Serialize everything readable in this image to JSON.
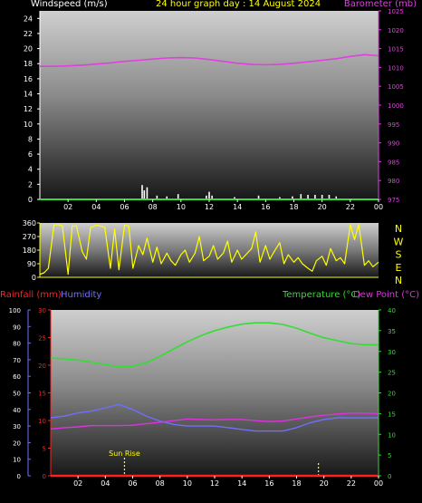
{
  "header": {
    "left_label": "Windspeed (m/s)",
    "title": "24 hour graph day : 14 August 2024",
    "right_label": "Barometer (mb)"
  },
  "colors": {
    "background": "#000000",
    "wind_text": "#ffffff",
    "title_text": "#ffff00",
    "baro": "#e040e0",
    "wind_dir": "#ffff00",
    "rain": "#ff2020",
    "humidity": "#6f6fff",
    "temperature": "#33dd33",
    "dew_point": "#dd33dd",
    "sunrise": "#ffff00",
    "axis_green": "#33dd33"
  },
  "time_ticks": [
    "02",
    "04",
    "06",
    "08",
    "10",
    "12",
    "14",
    "16",
    "18",
    "20",
    "22",
    "00"
  ],
  "chart_data": [
    {
      "type": "line",
      "name": "windspeed-barometer",
      "y_left": {
        "label": "Windspeed (m/s)",
        "ticks": [
          0,
          2,
          4,
          6,
          8,
          10,
          12,
          14,
          16,
          18,
          20,
          22,
          24
        ],
        "range": [
          0,
          25
        ]
      },
      "y_right": {
        "label": "Barometer (mb)",
        "ticks": [
          975,
          980,
          985,
          990,
          995,
          1000,
          1005,
          1010,
          1015,
          1020,
          1025
        ],
        "range": [
          975,
          1025
        ]
      },
      "barometer": {
        "x": [
          0,
          1,
          2,
          3,
          4,
          5,
          6,
          7,
          8,
          9,
          10,
          11,
          12,
          13,
          14,
          15,
          16,
          17,
          18,
          19,
          20,
          21,
          22,
          23,
          24
        ],
        "values": [
          1010.3,
          1010.3,
          1010.4,
          1010.6,
          1010.9,
          1011.2,
          1011.6,
          1011.9,
          1012.2,
          1012.5,
          1012.6,
          1012.5,
          1012.1,
          1011.6,
          1011.1,
          1010.8,
          1010.7,
          1010.8,
          1011.1,
          1011.5,
          1011.9,
          1012.3,
          1012.9,
          1013.4,
          1013.1
        ]
      },
      "wind_bars": [
        {
          "x": 7.25,
          "value": 1.9
        },
        {
          "x": 7.4,
          "value": 1.2
        },
        {
          "x": 7.6,
          "value": 1.6
        },
        {
          "x": 8.3,
          "value": 0.5
        },
        {
          "x": 9.0,
          "value": 0.4
        },
        {
          "x": 9.8,
          "value": 0.7
        },
        {
          "x": 11.8,
          "value": 0.5
        },
        {
          "x": 12.0,
          "value": 1.0
        },
        {
          "x": 12.2,
          "value": 0.5
        },
        {
          "x": 13.8,
          "value": 0.3
        },
        {
          "x": 15.5,
          "value": 0.5
        },
        {
          "x": 17.0,
          "value": 0.3
        },
        {
          "x": 17.9,
          "value": 0.4
        },
        {
          "x": 18.5,
          "value": 0.7
        },
        {
          "x": 19.0,
          "value": 0.6
        },
        {
          "x": 19.5,
          "value": 0.6
        },
        {
          "x": 20.0,
          "value": 0.6
        },
        {
          "x": 20.5,
          "value": 0.6
        },
        {
          "x": 21.0,
          "value": 0.4
        }
      ]
    },
    {
      "type": "line",
      "name": "wind-direction",
      "y_left": {
        "ticks": [
          0,
          90,
          180,
          270,
          360
        ],
        "range": [
          0,
          360
        ]
      },
      "compass": [
        "N",
        "W",
        "S",
        "E",
        "N"
      ],
      "x": [
        0,
        0.3,
        0.6,
        1,
        1.3,
        1.6,
        2,
        2.3,
        2.6,
        3,
        3.3,
        3.6,
        4,
        4.3,
        4.6,
        5,
        5.3,
        5.6,
        6,
        6.3,
        6.6,
        7,
        7.3,
        7.6,
        8,
        8.3,
        8.6,
        9,
        9.3,
        9.6,
        10,
        10.3,
        10.6,
        11,
        11.3,
        11.6,
        12,
        12.3,
        12.6,
        13,
        13.3,
        13.6,
        14,
        14.3,
        14.6,
        15,
        15.3,
        15.6,
        16,
        16.3,
        16.6,
        17,
        17.3,
        17.6,
        18,
        18.3,
        18.6,
        19,
        19.3,
        19.6,
        20,
        20.3,
        20.6,
        21,
        21.3,
        21.6,
        22,
        22.3,
        22.6,
        23,
        23.3,
        23.6,
        24
      ],
      "values": [
        20,
        30,
        60,
        345,
        350,
        340,
        20,
        340,
        340,
        170,
        120,
        330,
        345,
        340,
        330,
        60,
        320,
        50,
        345,
        340,
        60,
        210,
        150,
        260,
        100,
        200,
        90,
        160,
        110,
        80,
        150,
        180,
        100,
        160,
        270,
        110,
        140,
        210,
        120,
        160,
        240,
        100,
        180,
        120,
        150,
        190,
        300,
        100,
        210,
        120,
        170,
        230,
        90,
        150,
        100,
        130,
        90,
        60,
        40,
        110,
        140,
        80,
        190,
        110,
        130,
        90,
        350,
        250,
        350,
        80,
        110,
        70,
        100
      ]
    },
    {
      "type": "line",
      "name": "rain-humidity-temperature",
      "y_rain": {
        "label": "Rainfall (mm)",
        "ticks": [
          0,
          5,
          10,
          15,
          20,
          25,
          30
        ],
        "range": [
          0,
          30
        ]
      },
      "y_humidity": {
        "label": "Humidity",
        "ticks": [
          0,
          10,
          20,
          30,
          40,
          50,
          60,
          70,
          80,
          90,
          100
        ],
        "range": [
          0,
          100
        ]
      },
      "y_temp": {
        "label": "Temperature (°C)",
        "ticks": [
          0,
          5,
          10,
          15,
          20,
          25,
          30,
          35,
          40
        ],
        "range": [
          0,
          40
        ]
      },
      "dew_label": "Dew Point (°C)",
      "sunrise_label": "Sun Rise",
      "sunrise_hour": 5.4,
      "sunset_hour": 19.6,
      "x": [
        0,
        1,
        2,
        3,
        4,
        5,
        6,
        7,
        8,
        9,
        10,
        11,
        12,
        13,
        14,
        15,
        16,
        17,
        18,
        19,
        20,
        21,
        22,
        23,
        24
      ],
      "temperature": [
        28.4,
        28.2,
        27.9,
        27.4,
        26.8,
        26.3,
        26.4,
        27.3,
        28.8,
        30.6,
        32.3,
        33.8,
        35.0,
        35.9,
        36.6,
        36.9,
        36.9,
        36.5,
        35.6,
        34.4,
        33.3,
        32.6,
        31.9,
        31.6,
        31.6
      ],
      "humidity": [
        35,
        36,
        38,
        39,
        41,
        43,
        40,
        36,
        33,
        31,
        30,
        30,
        30,
        29,
        28,
        27,
        27,
        27,
        29,
        32,
        34,
        35,
        35,
        35,
        35
      ],
      "dew_point": [
        11.3,
        11.6,
        11.8,
        12.1,
        12.1,
        12.1,
        12.2,
        12.6,
        12.9,
        13.3,
        13.7,
        13.6,
        13.5,
        13.6,
        13.6,
        13.3,
        13.1,
        13.2,
        13.7,
        14.2,
        14.6,
        14.9,
        15.1,
        15.1,
        15.0
      ],
      "rainfall": [
        0,
        0,
        0,
        0,
        0,
        0,
        0,
        0,
        0,
        0,
        0,
        0,
        0,
        0,
        0,
        0,
        0,
        0,
        0,
        0,
        0,
        0,
        0,
        0,
        0
      ]
    }
  ]
}
